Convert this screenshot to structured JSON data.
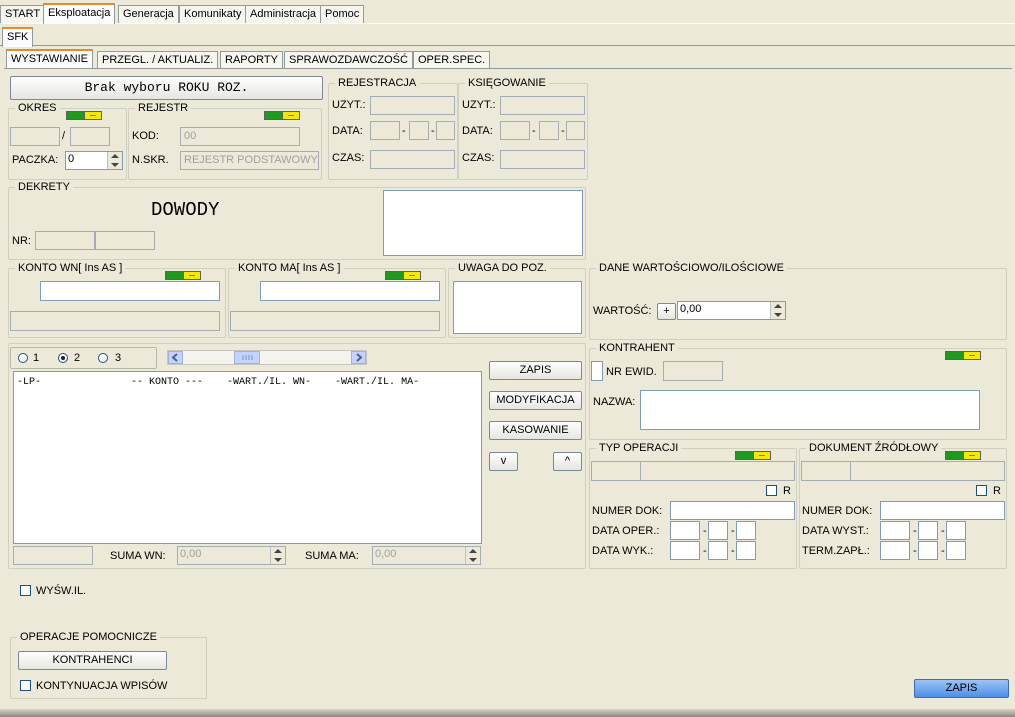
{
  "menu": [
    "START",
    "Eksploatacja",
    "Generacja",
    "Komunikaty",
    "Administracja",
    "Pomoc"
  ],
  "module_tab": "SFK",
  "tabs": [
    "WYSTAWIANIE",
    "PRZEGL. / AKTUALIZ.",
    "RAPORTY",
    "SPRAWOZDAWCZOŚĆ",
    "OPER.SPEC."
  ],
  "year_button": "Brak wyboru ROKU ROZ.",
  "okres": {
    "title": "OKRES",
    "slash": "/",
    "paczka_label": "PACZKA:",
    "paczka_value": "0"
  },
  "rejestr": {
    "title": "REJESTR",
    "kod_label": "KOD:",
    "kod_value": "00",
    "nskr_label": "N.SKR.",
    "nskr_value": "REJESTR PODSTAWOWY"
  },
  "rejestracja": {
    "title": "REJESTRACJA",
    "uzyt": "UZYT.:",
    "data": "DATA:",
    "czas": "CZAS:",
    "sep": "-"
  },
  "ksiegowanie": {
    "title": "KSIĘGOWANIE",
    "uzyt": "UZYT.:",
    "data": "DATA:",
    "czas": "CZAS:",
    "sep": "-"
  },
  "dekrety": {
    "title": "DEKRETY",
    "dowody": "DOWODY",
    "nr": "NR:"
  },
  "konto_wn": {
    "title": "KONTO WN[ Ins AS ]"
  },
  "konto_ma": {
    "title": "KONTO MA[ Ins AS ]"
  },
  "uwaga": {
    "title": "UWAGA DO POZ."
  },
  "dane": {
    "title": "DANE WARTOŚCIOWO/ILOŚCIOWE",
    "wartosc_label": "WARTOŚĆ:",
    "plus": "+",
    "wartosc_value": "0,00"
  },
  "radios": [
    "1",
    "2",
    "3"
  ],
  "radio_selected": "2",
  "list_header": "-LP-               -- KONTO ---    -WART./IL. WN-    -WART./IL. MA-",
  "buttons": {
    "zapis": "ZAPIS",
    "modyfikacja": "MODYFIKACJA",
    "kasowanie": "KASOWANIE",
    "down": "v",
    "up": "^"
  },
  "suma": {
    "wn_label": "SUMA WN:",
    "wn_value": "0,00",
    "ma_label": "SUMA MA:",
    "ma_value": "0,00"
  },
  "kontrahent": {
    "title": "KONTRAHENT",
    "nr_ewid": "NR EWID.",
    "nazwa": "NAZWA:"
  },
  "typ_operacji": {
    "title": "TYP OPERACJI",
    "r": "R",
    "numer_dok": "NUMER DOK:",
    "data_oper": "DATA OPER.:",
    "data_wyk": "DATA WYK.:",
    "sep": "-"
  },
  "dokument": {
    "title": "DOKUMENT ŹRÓDŁOWY",
    "r": "R",
    "numer_dok": "NUMER DOK:",
    "data_wyst": "DATA WYST.:",
    "term_zapl": "TERM.ZAPŁ.:",
    "sep": "-"
  },
  "wysw": "WYŚW.IL.",
  "operacje": {
    "title": "OPERACJE POMOCNICZE",
    "kontrahenci": "KONTRAHENCI",
    "kontynuacja": "KONTYNUACJA WPISÓW"
  },
  "bottom_zapis": "ZAPIS",
  "colors": {
    "tab_accent": "#e68b2c",
    "indicator_green": "#1f9a1f",
    "indicator_yellow": "#f5e900",
    "save_blue": "#4c8fe8"
  }
}
